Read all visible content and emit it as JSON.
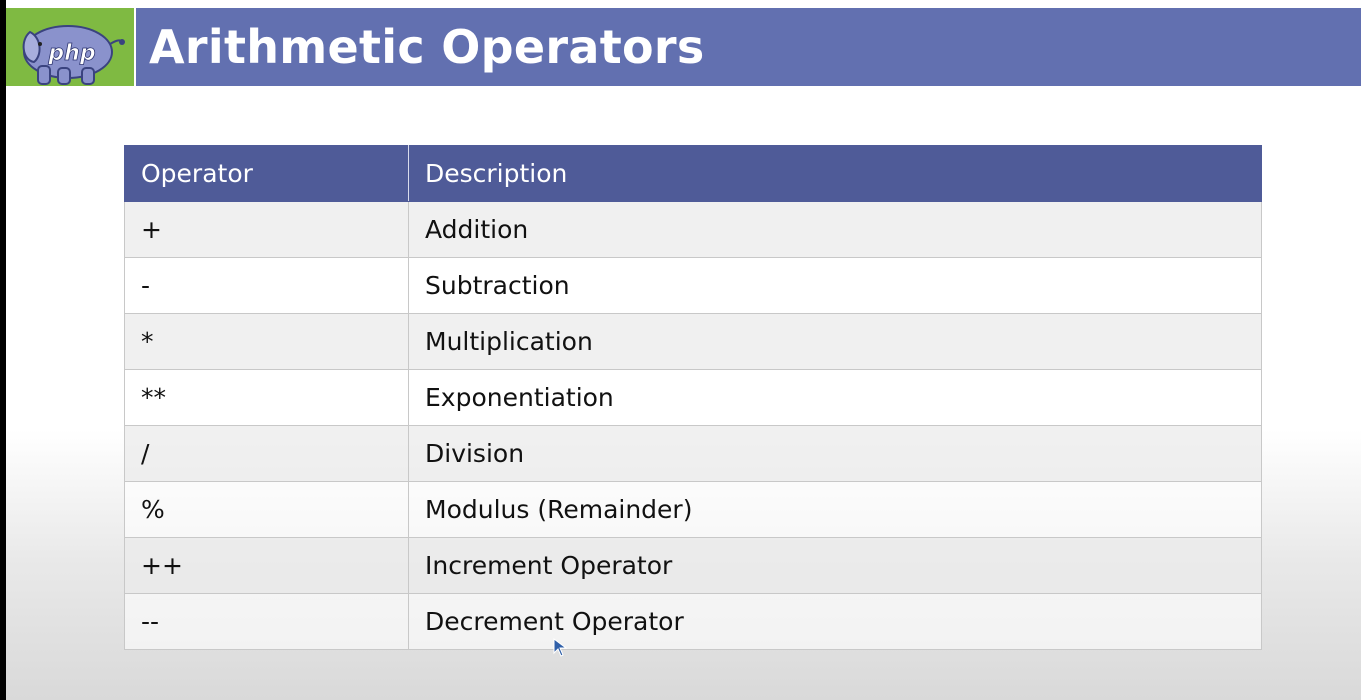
{
  "slide": {
    "title": "Arithmetic Operators",
    "logo_text": "php"
  },
  "table": {
    "headers": [
      "Operator",
      "Description"
    ],
    "rows": [
      {
        "operator": "+",
        "description": "Addition"
      },
      {
        "operator": "-",
        "description": "Subtraction"
      },
      {
        "operator": "*",
        "description": "Multiplication"
      },
      {
        "operator": "**",
        "description": "Exponentiation"
      },
      {
        "operator": "/",
        "description": "Division"
      },
      {
        "operator": "%",
        "description": "Modulus (Remainder)"
      },
      {
        "operator": "++",
        "description": "Increment Operator"
      },
      {
        "operator": "--",
        "description": "Decrement Operator"
      }
    ]
  },
  "colors": {
    "title_bar": "#6270b0",
    "table_header": "#4f5b98",
    "logo_background": "#7fba42"
  }
}
